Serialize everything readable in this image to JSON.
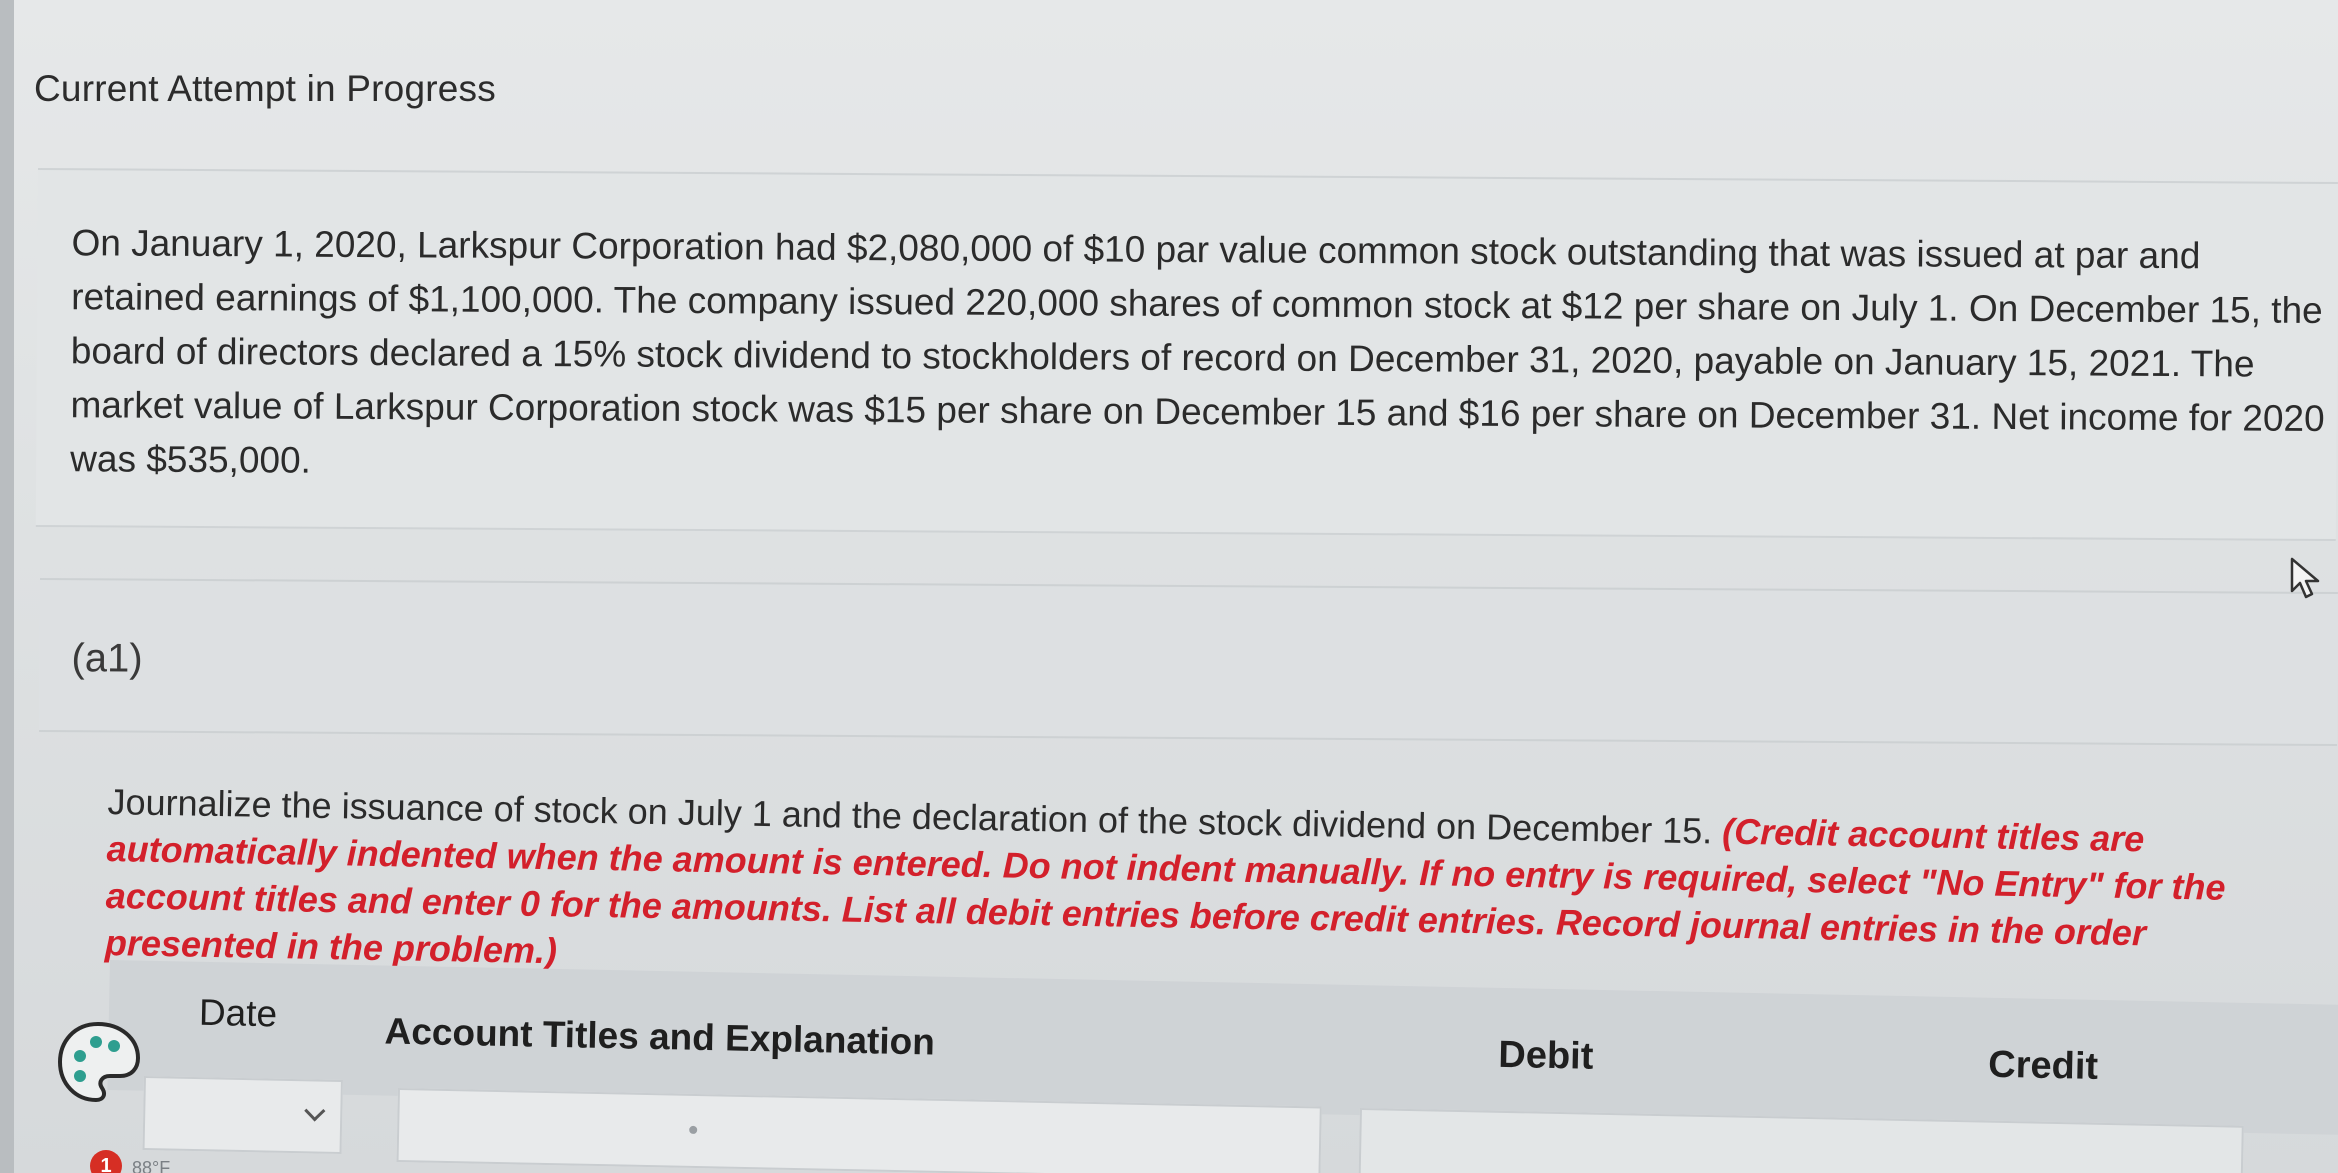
{
  "header": {
    "attempt_title": "Current Attempt in Progress"
  },
  "problem": {
    "text": "On January 1, 2020, Larkspur Corporation had $2,080,000 of $10 par value common stock outstanding that was issued at par and retained earnings of $1,100,000. The company issued 220,000 shares of common stock at $12 per share on July 1. On December 15, the board of directors declared a 15% stock dividend to stockholders of record on December 31, 2020, payable on January 15, 2021. The market value of Larkspur Corporation stock was $15 per share on December 15 and $16 per share on December 31. Net income for 2020 was $535,000."
  },
  "part": {
    "label": "(a1)"
  },
  "instructions": {
    "main": "Journalize the issuance of stock on July 1 and the declaration of the stock dividend on December 15. ",
    "note": "(Credit account titles are automatically indented when the amount is entered. Do not indent manually. If no entry is required, select \"No Entry\" for the account titles and enter 0 for the amounts. List all debit entries before credit entries. Record journal entries in the order presented in the problem.)"
  },
  "table": {
    "columns": {
      "date": "Date",
      "account": "Account Titles and Explanation",
      "debit": "Debit",
      "credit": "Credit"
    },
    "row": {
      "date_value": "",
      "account_value": "",
      "credit_value": ""
    }
  },
  "taskbar": {
    "badge_count": "1",
    "temperature": "88°F"
  },
  "icons": {
    "cursor": "cursor-icon",
    "palette": "palette-icon",
    "dropdown": "chevron-down-icon"
  },
  "colors": {
    "note_red": "#d3202b",
    "badge_red": "#d62e24",
    "text": "#2b2b2b"
  }
}
